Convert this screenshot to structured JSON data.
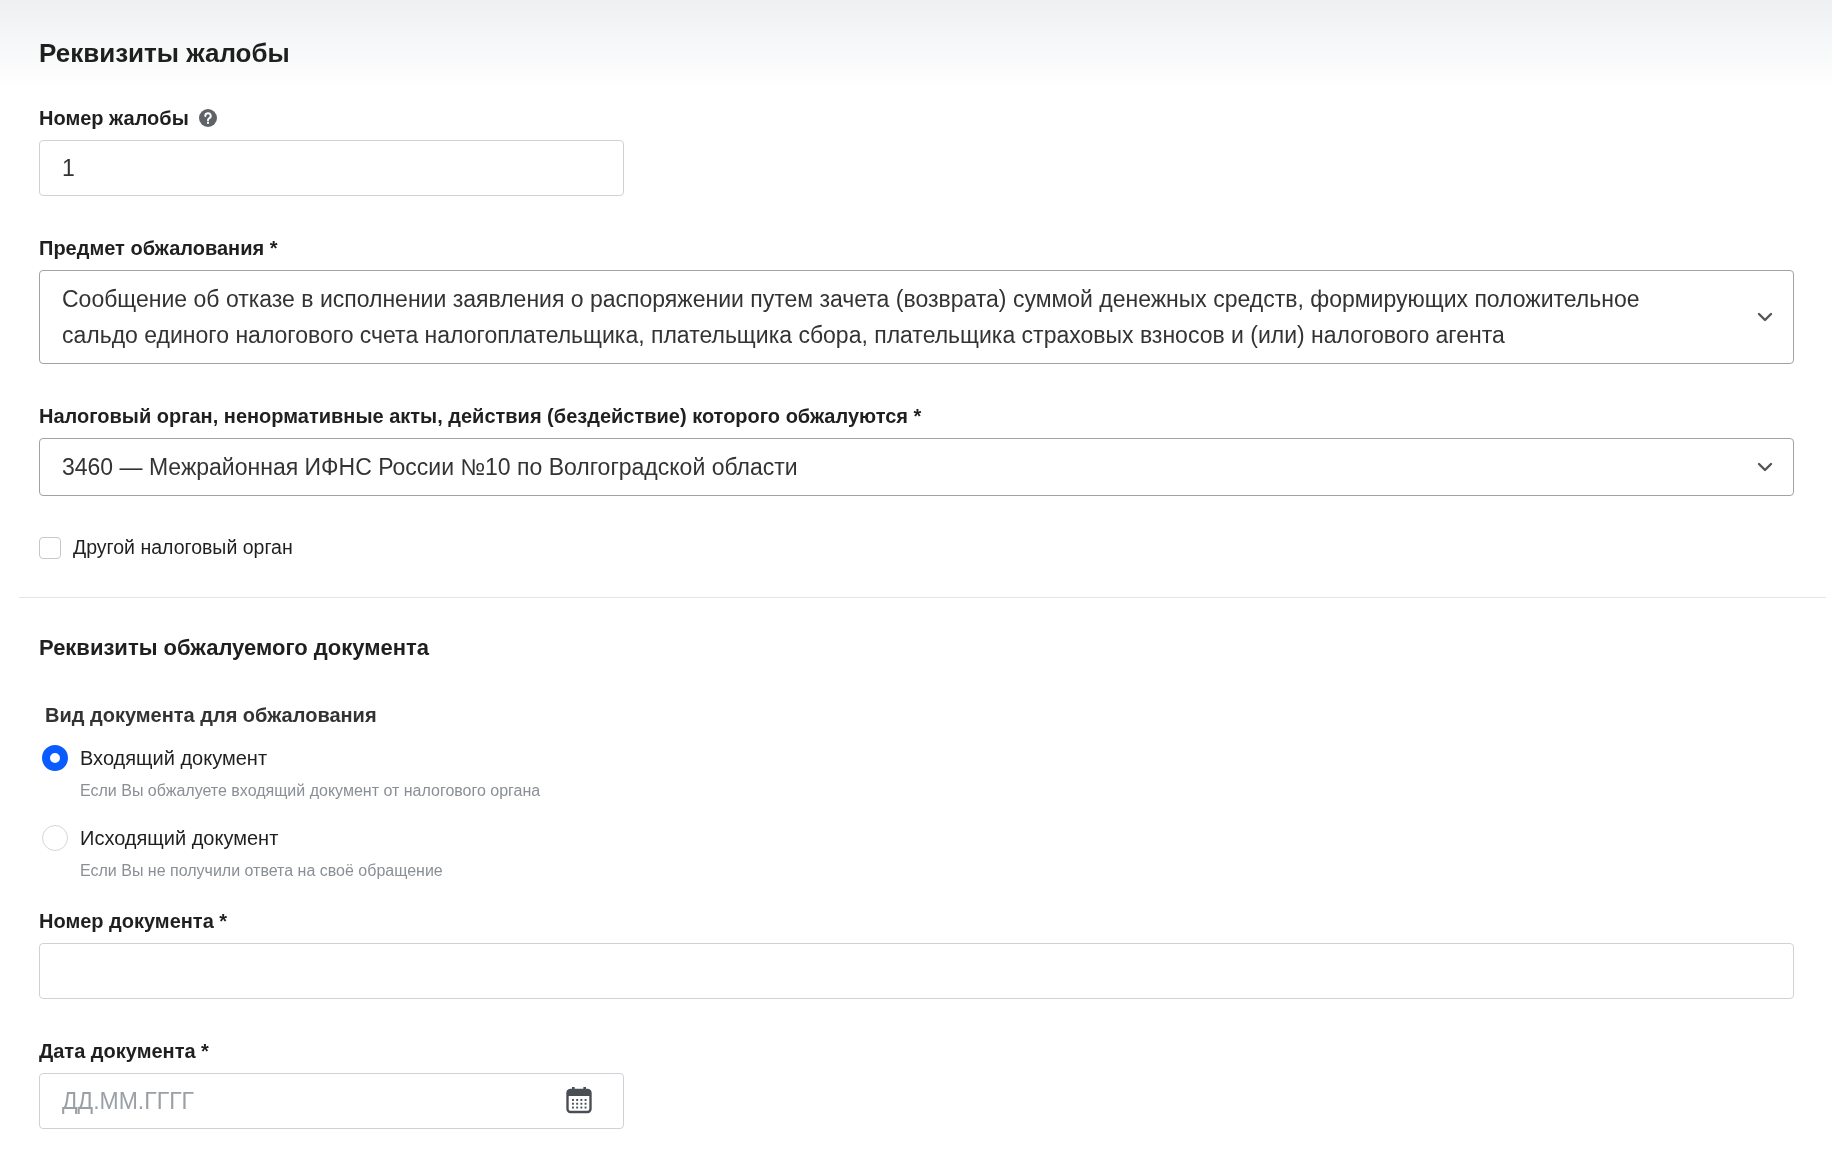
{
  "sections": [
    {
      "kind": "main",
      "title": "Реквизиты жалобы",
      "items": [
        {
          "kind": "number",
          "label": "Номер жалобы",
          "help": true,
          "value": "1"
        },
        {
          "kind": "select",
          "label": "Предмет обжалования *",
          "value": "Сообщение об отказе в исполнении заявления о распоряжении путем зачета (возврата) суммой денежных средств, формирующих положительное сальдо единого налогового счета налогоплательщика, плательщика сбора, плательщика страховых взносов и (или) налогового агента"
        },
        {
          "kind": "select",
          "label": "Налоговый орган, ненормативные акты, действия (бездействие) которого обжалуются *",
          "value": "3460 — Межрайонная ИФНС России №10 по Волгоградской области"
        },
        {
          "kind": "checkbox",
          "label": "Другой налоговый орган",
          "checked": false
        }
      ]
    },
    {
      "kind": "sub",
      "title": "Реквизиты обжалуемого документа",
      "items": [
        {
          "kind": "radio",
          "label": "Вид документа для обжалования",
          "options": [
            {
              "label": "Входящий документ",
              "hint": "Если Вы обжалуете входящий документ от налогового органа",
              "selected": true
            },
            {
              "label": "Исходящий документ",
              "hint": "Если Вы не получили ответа на своё обращение",
              "selected": false
            }
          ]
        },
        {
          "kind": "text",
          "label": "Номер документа *"
        },
        {
          "kind": "date",
          "label": "Дата документа *",
          "placeholder": "ДД.ММ.ГГГГ"
        }
      ]
    }
  ]
}
